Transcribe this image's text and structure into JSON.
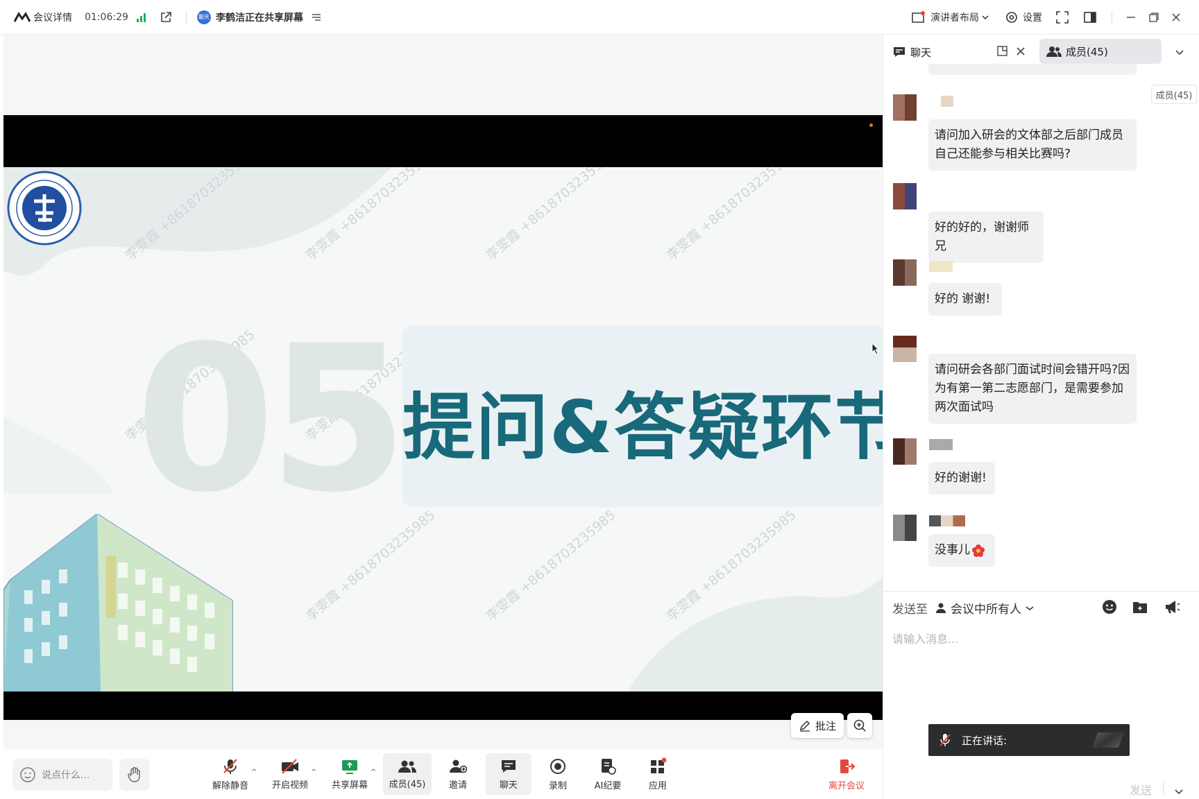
{
  "topbar": {
    "meeting_details": "会议详情",
    "timer": "01:06:29",
    "sharer_badge": "聊天",
    "sharing_status": "李鹤洁正在共享屏幕",
    "presenter_layout": "演讲者布局",
    "settings": "设置"
  },
  "slide": {
    "number": "05",
    "title": "提问&答疑环节",
    "watermark": "李雯霞 +8618703235985",
    "accent_color": "#18697a"
  },
  "overlay": {
    "annotate": "批注"
  },
  "bottombar": {
    "say_something": "说点什么...",
    "unmute": "解除静音",
    "start_video": "开启视频",
    "share_screen": "共享屏幕",
    "members": "成员(45)",
    "invite": "邀请",
    "chat": "聊天",
    "record": "录制",
    "ai_minutes": "AI纪要",
    "apps": "应用",
    "leave": "离开会议",
    "leave_color": "#e5483a"
  },
  "panel": {
    "chat_tab": "聊天",
    "members_tab": "成员(45)",
    "members_side": "成员(45)",
    "send_to_label": "发送至",
    "send_to_target": "会议中所有人",
    "input_placeholder": "请输入消息...",
    "send_button": "发送",
    "speaking_label": "正在讲话:"
  },
  "messages": [
    {
      "text": "请问加入研会的文体部之后部门成员自己还能参与相关比赛吗?"
    },
    {
      "text": "好的好的，谢谢师兄"
    },
    {
      "text": "好的 谢谢!"
    },
    {
      "text": "请问研会各部门面试时间会错开吗?因为有第一第二志愿部门，是需要参加两次面试吗"
    },
    {
      "text": "好的谢谢!"
    },
    {
      "text": "没事儿"
    }
  ]
}
